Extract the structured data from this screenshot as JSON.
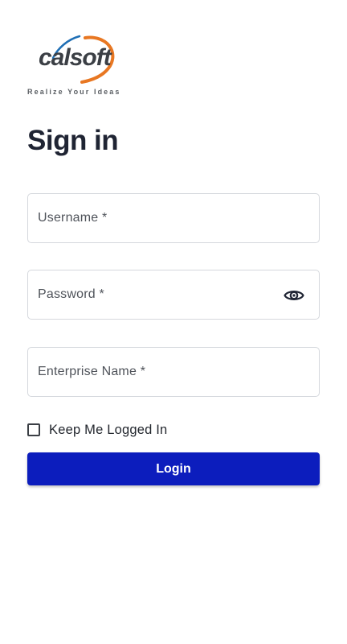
{
  "logo": {
    "wordmark": "calsoft",
    "tagline": "Realize Your Ideas",
    "colors": {
      "orange": "#e87722",
      "blue": "#1f6fb5",
      "text": "#3b3f45"
    }
  },
  "page_title": "Sign in",
  "form": {
    "username": {
      "placeholder": "Username *",
      "value": ""
    },
    "password": {
      "placeholder": "Password *",
      "value": "",
      "toggle_icon": "eye-icon"
    },
    "enterprise": {
      "placeholder": "Enterprise Name *",
      "value": ""
    },
    "keep_logged_in": {
      "label": "Keep Me Logged In",
      "checked": false
    },
    "submit_label": "Login"
  },
  "colors": {
    "primary": "#0c1dbd",
    "title": "#1f2433",
    "border": "#d5d8dd"
  }
}
